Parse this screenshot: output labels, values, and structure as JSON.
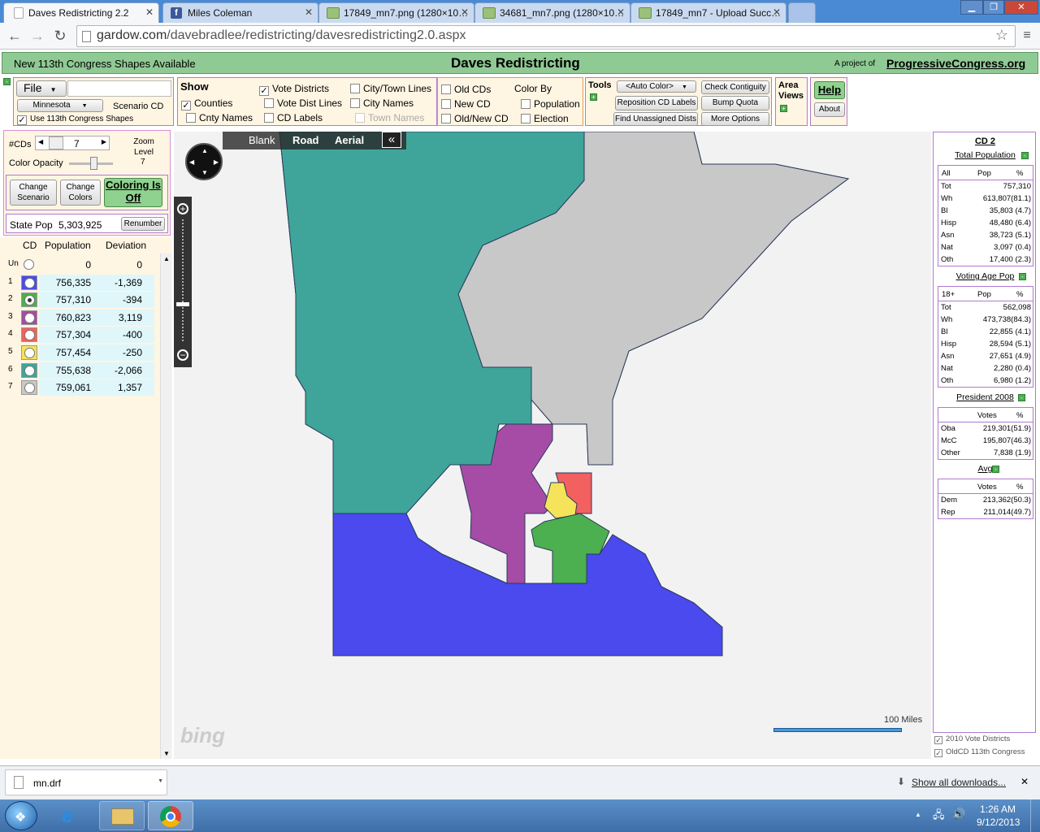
{
  "browser": {
    "tabs": [
      {
        "title": "Daves Redistricting 2.2",
        "icon": "page-icon"
      },
      {
        "title": "Miles Coleman",
        "icon": "facebook-icon"
      },
      {
        "title": "17849_mn7.png (1280×10…",
        "icon": "image-icon"
      },
      {
        "title": "34681_mn7.png (1280×10…",
        "icon": "image-icon"
      },
      {
        "title": "17849_mn7 - Upload Succ…",
        "icon": "image-icon"
      }
    ],
    "url_host": "gardow.com",
    "url_path": "/davebradlee/redistricting/davesredistricting2.0.aspx"
  },
  "banner": {
    "left": "New 113th Congress Shapes Available",
    "title": "Daves Redistricting",
    "project_prefix": "A project of",
    "project_link": "ProgressiveCongress.org"
  },
  "file_panel": {
    "file_label": "File",
    "state": "Minnesota",
    "scenario": "Scenario CD",
    "use113": "Use 113th Congress Shapes"
  },
  "show_panel": {
    "title": "Show",
    "items": [
      {
        "label": "Vote Districts",
        "checked": true
      },
      {
        "label": "City/Town Lines",
        "checked": false
      },
      {
        "label": "Counties",
        "checked": true
      },
      {
        "label": "Vote Dist Lines",
        "checked": false
      },
      {
        "label": "City Names",
        "checked": false
      },
      {
        "label": "Cnty Names",
        "checked": false
      },
      {
        "label": "CD Labels",
        "checked": false
      },
      {
        "label": "Town Names",
        "checked": false
      }
    ],
    "old_cds": "Old CDs",
    "new_cd": "New CD",
    "old_new_cd": "Old/New CD",
    "color_by": "Color By",
    "population": "Population",
    "election": "Election"
  },
  "tools_panel": {
    "title": "Tools",
    "auto_color": "<Auto Color>",
    "check_contiguity": "Check Contiguity",
    "reposition": "Reposition CD Labels",
    "bump_quota": "Bump Quota",
    "find_unassigned": "Find Unassigned Dists",
    "more_options": "More Options"
  },
  "area_views": {
    "title_line1": "Area",
    "title_line2": "Views"
  },
  "help_panel": {
    "help": "Help",
    "about": "About"
  },
  "left_panel": {
    "cds_label": "#CDs",
    "cds_value": "7",
    "opacity_label": "Color Opacity",
    "zoom_label": "Zoom Level",
    "zoom_value": "7",
    "change_scenario": "Change Scenario",
    "change_colors": "Change Colors",
    "coloring": "Coloring Is Off",
    "state_pop_label": "State Pop",
    "state_pop": "5,303,925",
    "renumber": "Renumber",
    "headers": {
      "cd": "CD",
      "population": "Population",
      "deviation": "Deviation"
    },
    "rows": [
      {
        "num": "Un",
        "color": "#ffffff",
        "population": "0",
        "deviation": "0",
        "selected": false
      },
      {
        "num": "1",
        "color": "#4a4aee",
        "population": "756,335",
        "deviation": "-1,369",
        "selected": false
      },
      {
        "num": "2",
        "color": "#4caf50",
        "population": "757,310",
        "deviation": "-394",
        "selected": true
      },
      {
        "num": "3",
        "color": "#a64ca6",
        "population": "760,823",
        "deviation": "3,119",
        "selected": false
      },
      {
        "num": "4",
        "color": "#f26060",
        "population": "757,304",
        "deviation": "-400",
        "selected": false
      },
      {
        "num": "5",
        "color": "#f5e35a",
        "population": "757,454",
        "deviation": "-250",
        "selected": false
      },
      {
        "num": "6",
        "color": "#3fa59a",
        "population": "755,638",
        "deviation": "-2,066",
        "selected": false
      },
      {
        "num": "7",
        "color": "#c8c8c8",
        "population": "759,061",
        "deviation": "1,357",
        "selected": false
      }
    ]
  },
  "map": {
    "tabs": [
      "Blank",
      "Road",
      "Aerial"
    ],
    "collapse": "«",
    "scale": "100 Miles",
    "logo": "bing",
    "colors": {
      "cd1": "#4a4aee",
      "cd2": "#4caf50",
      "cd3": "#a64ca6",
      "cd4": "#f26060",
      "cd5": "#f5e35a",
      "cd6": "#3fa59a",
      "cd7": "#c8c8c8"
    }
  },
  "stats": {
    "title": "CD 2",
    "total_pop_title": "Total Population",
    "total_pop": {
      "header": [
        "All",
        "Pop",
        "%"
      ],
      "rows": [
        [
          "Tot",
          "757,310"
        ],
        [
          "Wh",
          "613,807(81.1)"
        ],
        [
          "Bl",
          "35,803 (4.7)"
        ],
        [
          "Hisp",
          "48,480 (6.4)"
        ],
        [
          "Asn",
          "38,723 (5.1)"
        ],
        [
          "Nat",
          "3,097 (0.4)"
        ],
        [
          "Oth",
          "17,400 (2.3)"
        ]
      ]
    },
    "vap_title": "Voting Age Pop",
    "vap": {
      "header": [
        "18+",
        "Pop",
        "%"
      ],
      "rows": [
        [
          "Tot",
          "562,098"
        ],
        [
          "Wh",
          "473,738(84.3)"
        ],
        [
          "Bl",
          "22,855 (4.1)"
        ],
        [
          "Hisp",
          "28,594 (5.1)"
        ],
        [
          "Asn",
          "27,651 (4.9)"
        ],
        [
          "Nat",
          "2,280 (0.4)"
        ],
        [
          "Oth",
          "6,980 (1.2)"
        ]
      ]
    },
    "pres_title": "President 2008",
    "pres": {
      "header": [
        "",
        "Votes",
        "%"
      ],
      "rows": [
        [
          "Oba",
          "219,301(51.9)"
        ],
        [
          "McC",
          "195,807(46.3)"
        ],
        [
          "Other",
          "7,838 (1.9)"
        ]
      ]
    },
    "avg_title": "Avg",
    "avg": {
      "header": [
        "",
        "Votes",
        "%"
      ],
      "rows": [
        [
          "Dem",
          "213,362(50.3)"
        ],
        [
          "Rep",
          "211,014(49.7)"
        ]
      ]
    },
    "legend1": "2010 Vote Districts",
    "legend2": "OldCD 113th Congress"
  },
  "downloads": {
    "file": "mn.drf",
    "show_all": "Show all downloads..."
  },
  "taskbar": {
    "time": "1:26 AM",
    "date": "9/12/2013"
  }
}
